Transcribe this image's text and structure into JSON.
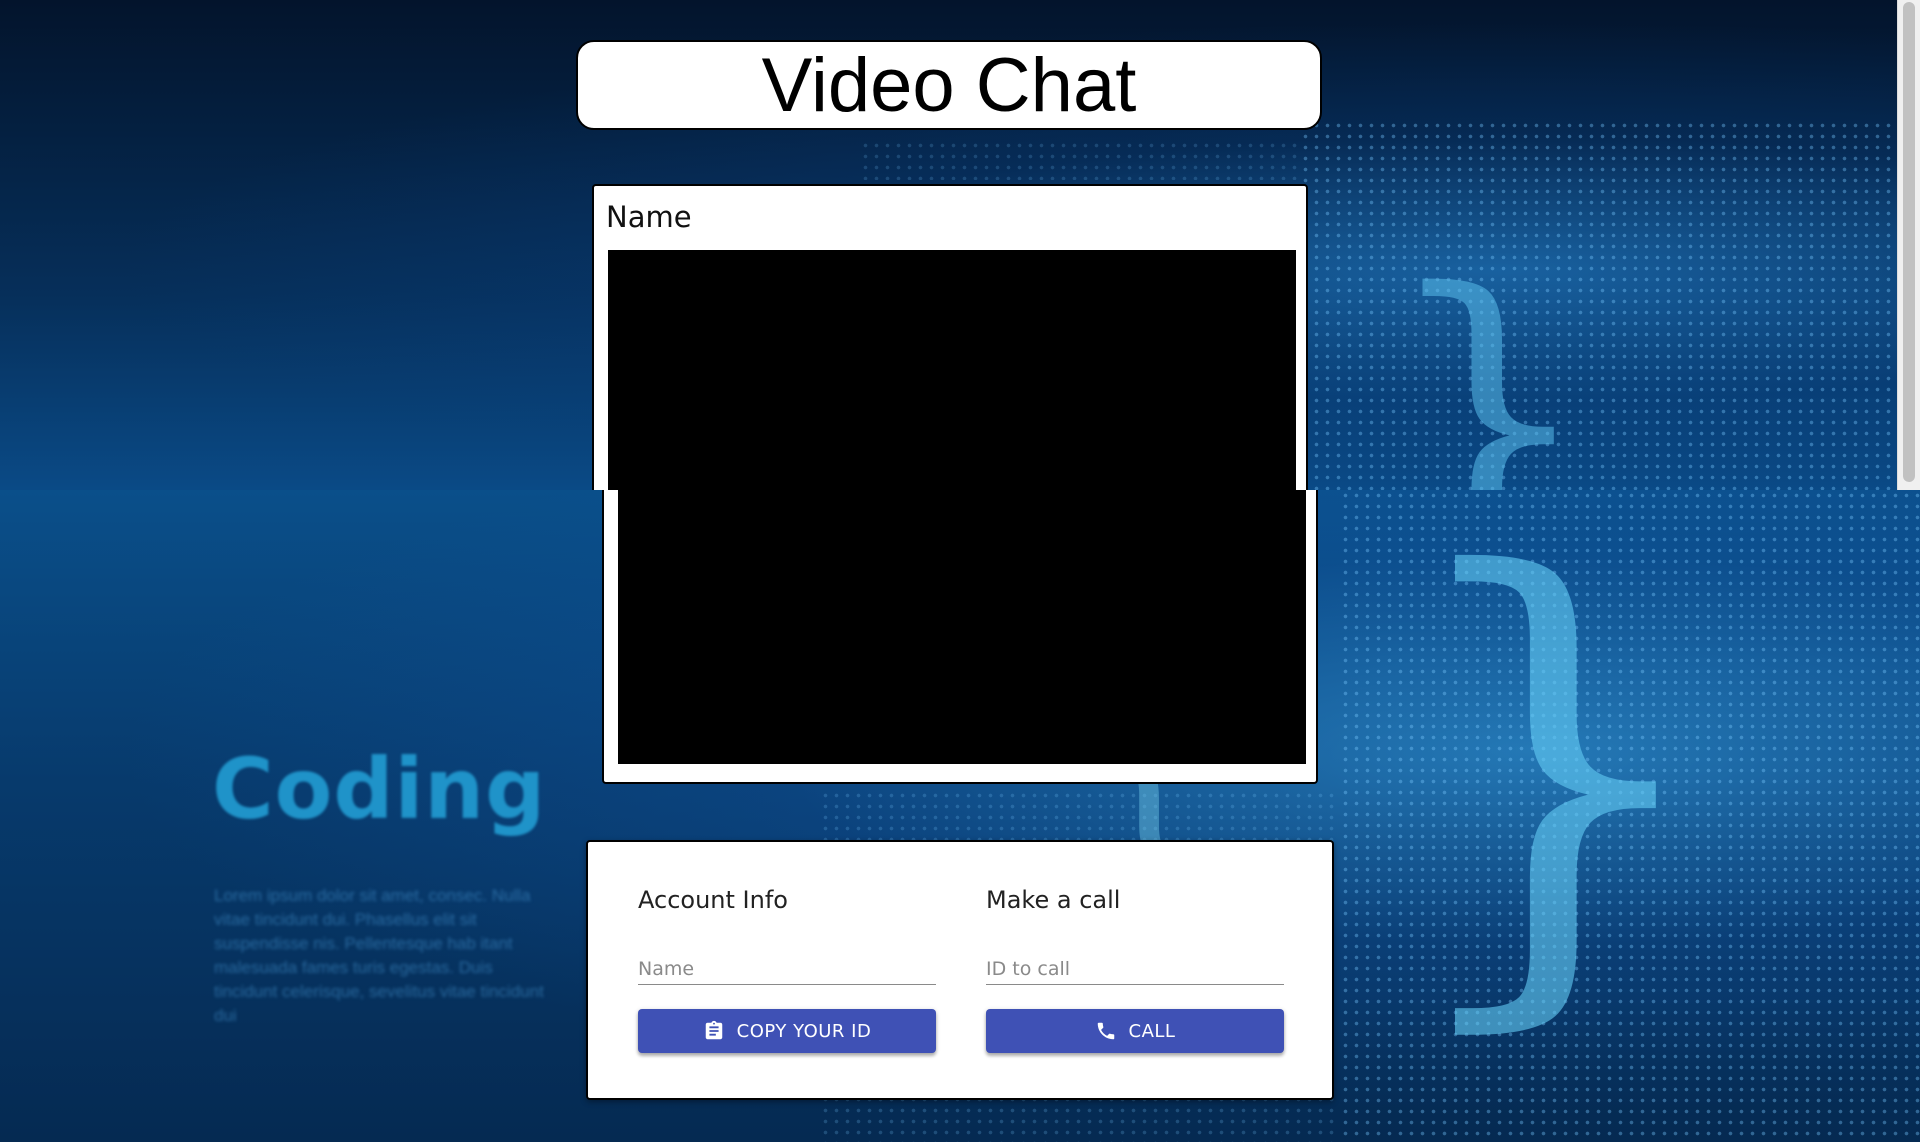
{
  "header": {
    "title": "Video Chat"
  },
  "video": {
    "name_label": "Name"
  },
  "account_info": {
    "heading": "Account Info",
    "name_placeholder": "Name",
    "copy_button_label": "COPY YOUR ID",
    "copy_icon": "clipboard-icon"
  },
  "make_call": {
    "heading": "Make a call",
    "id_placeholder": "ID to call",
    "call_button_label": "CALL",
    "call_icon": "phone-icon"
  },
  "background": {
    "word": "Coding",
    "filler_text": "Lorem ipsum dolor sit amet, consec. Nulla vitae tincidunt dui. Phasellus elit sit suspendisse nis. Pellentesque hab itant malesuada fames turis egestas. Duis tincidunt celerisque, sevelitus vitae tincidunt dui"
  },
  "colors": {
    "primary_button": "#3f51b5",
    "card_background": "#ffffff",
    "video_background": "#000000"
  }
}
